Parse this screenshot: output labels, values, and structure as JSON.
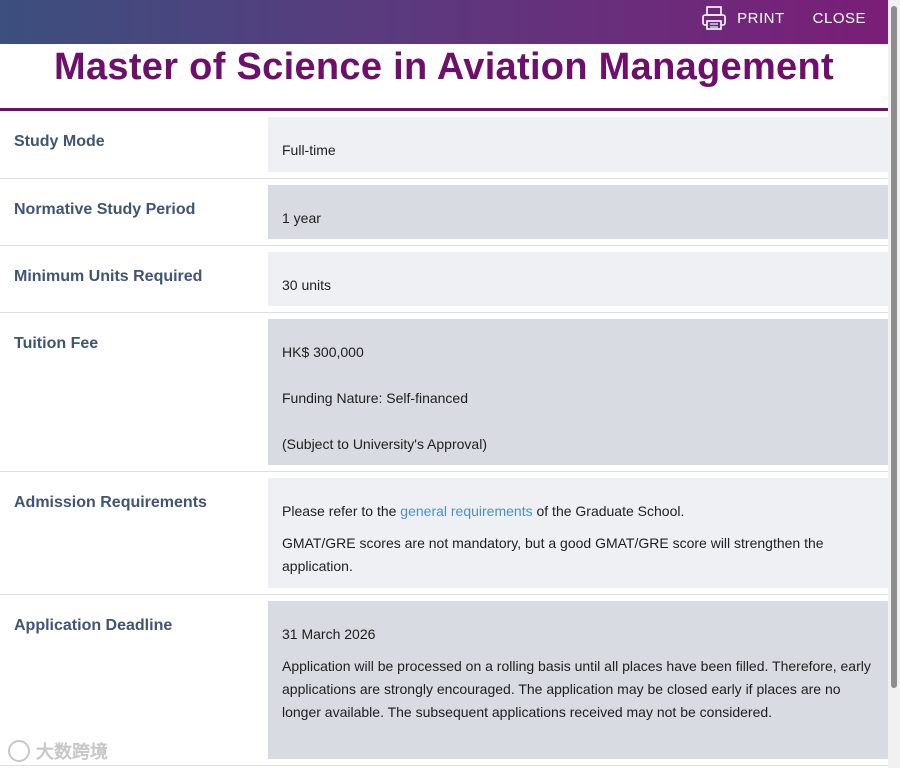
{
  "toolbar": {
    "print_label": "PRINT",
    "close_label": "CLOSE"
  },
  "page_title": "Master of Science in Aviation Management",
  "rows": {
    "study_mode": {
      "label": "Study Mode",
      "value": "Full-time"
    },
    "study_period": {
      "label": "Normative Study Period",
      "value": "1 year"
    },
    "min_units": {
      "label": "Minimum Units Required",
      "value": "30 units"
    },
    "tuition": {
      "label": "Tuition Fee",
      "fee": "HK$ 300,000",
      "funding": "Funding Nature: Self-financed",
      "note": "(Subject to University's Approval)"
    },
    "admission": {
      "label": "Admission Requirements",
      "refer_prefix": "Please refer to the ",
      "refer_link": "general requirements",
      "refer_suffix": " of the Graduate School.",
      "gmat": "GMAT/GRE scores are not mandatory, but a good GMAT/GRE score will strengthen the application."
    },
    "deadline": {
      "label": "Application Deadline",
      "date": "31 March 2026",
      "details": "Application will be processed on a rolling basis until all places have been filled. Therefore, early applications are strongly encouraged. The application may be closed early if places are no longer available. The subsequent applications received may not be considered."
    }
  },
  "watermark": "大数跨境",
  "colors": {
    "title": "#6d0f6b",
    "label": "#3f5573",
    "link": "#4d8ec9",
    "cell_light": "#eef0f4",
    "cell_dark": "#d8dbe2"
  }
}
